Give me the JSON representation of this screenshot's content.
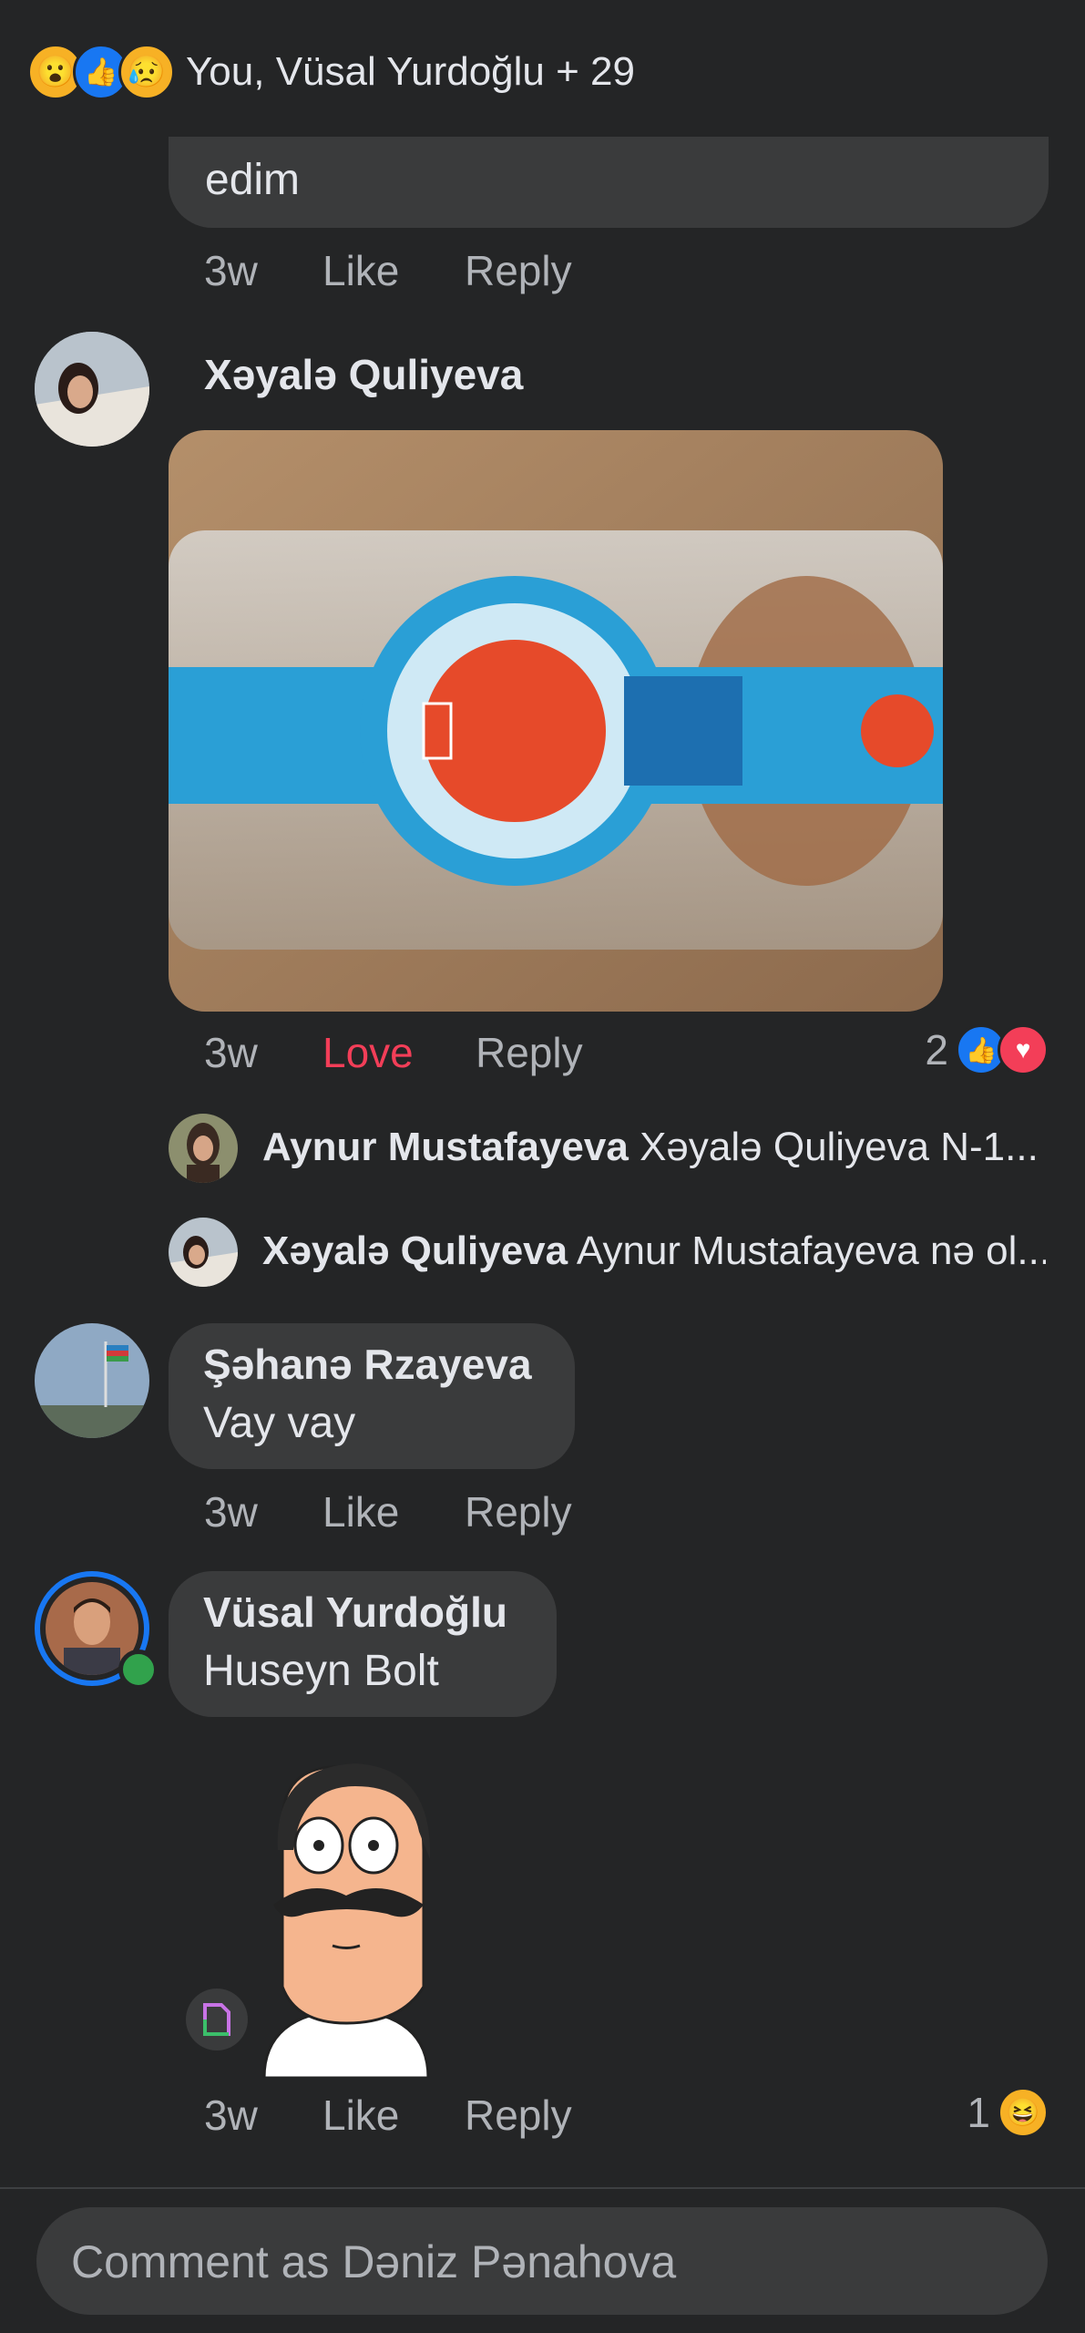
{
  "header": {
    "reaction_icons": [
      "wow-icon",
      "like-icon",
      "sad-icon"
    ],
    "summary_text": "You, Vüsal Yurdoğlu + 29"
  },
  "comments": {
    "c1": {
      "partial_text": "edim",
      "time": "3w",
      "like_label": "Like",
      "reply_label": "Reply"
    },
    "c2": {
      "author": "Xəyalə Quliyeva",
      "photo_alt": "Photo of packaged bread loaf",
      "time": "3w",
      "love_label": "Love",
      "reply_label": "Reply",
      "reaction_count": "2"
    },
    "c2_replies": [
      {
        "author": "Aynur Mustafayeva",
        "text": "Xəyalə Quliyeva N-1..."
      },
      {
        "author": "Xəyalə Quliyeva",
        "text": "Aynur Mustafayeva nə ol..."
      }
    ],
    "c3": {
      "author": "Şəhanə Rzayeva",
      "text": "Vay vay",
      "time": "3w",
      "like_label": "Like",
      "reply_label": "Reply"
    },
    "c4": {
      "author": "Vüsal Yurdoğlu",
      "text": "Huseyn Bolt",
      "time": "3w",
      "like_label": "Like",
      "reply_label": "Reply",
      "reaction_count": "1"
    }
  },
  "composer": {
    "placeholder": "Comment as Dəniz Pənahova"
  },
  "colors": {
    "background": "#242526",
    "bubble": "#3a3b3c",
    "love": "#f33e58",
    "like_blue": "#1877f2"
  }
}
